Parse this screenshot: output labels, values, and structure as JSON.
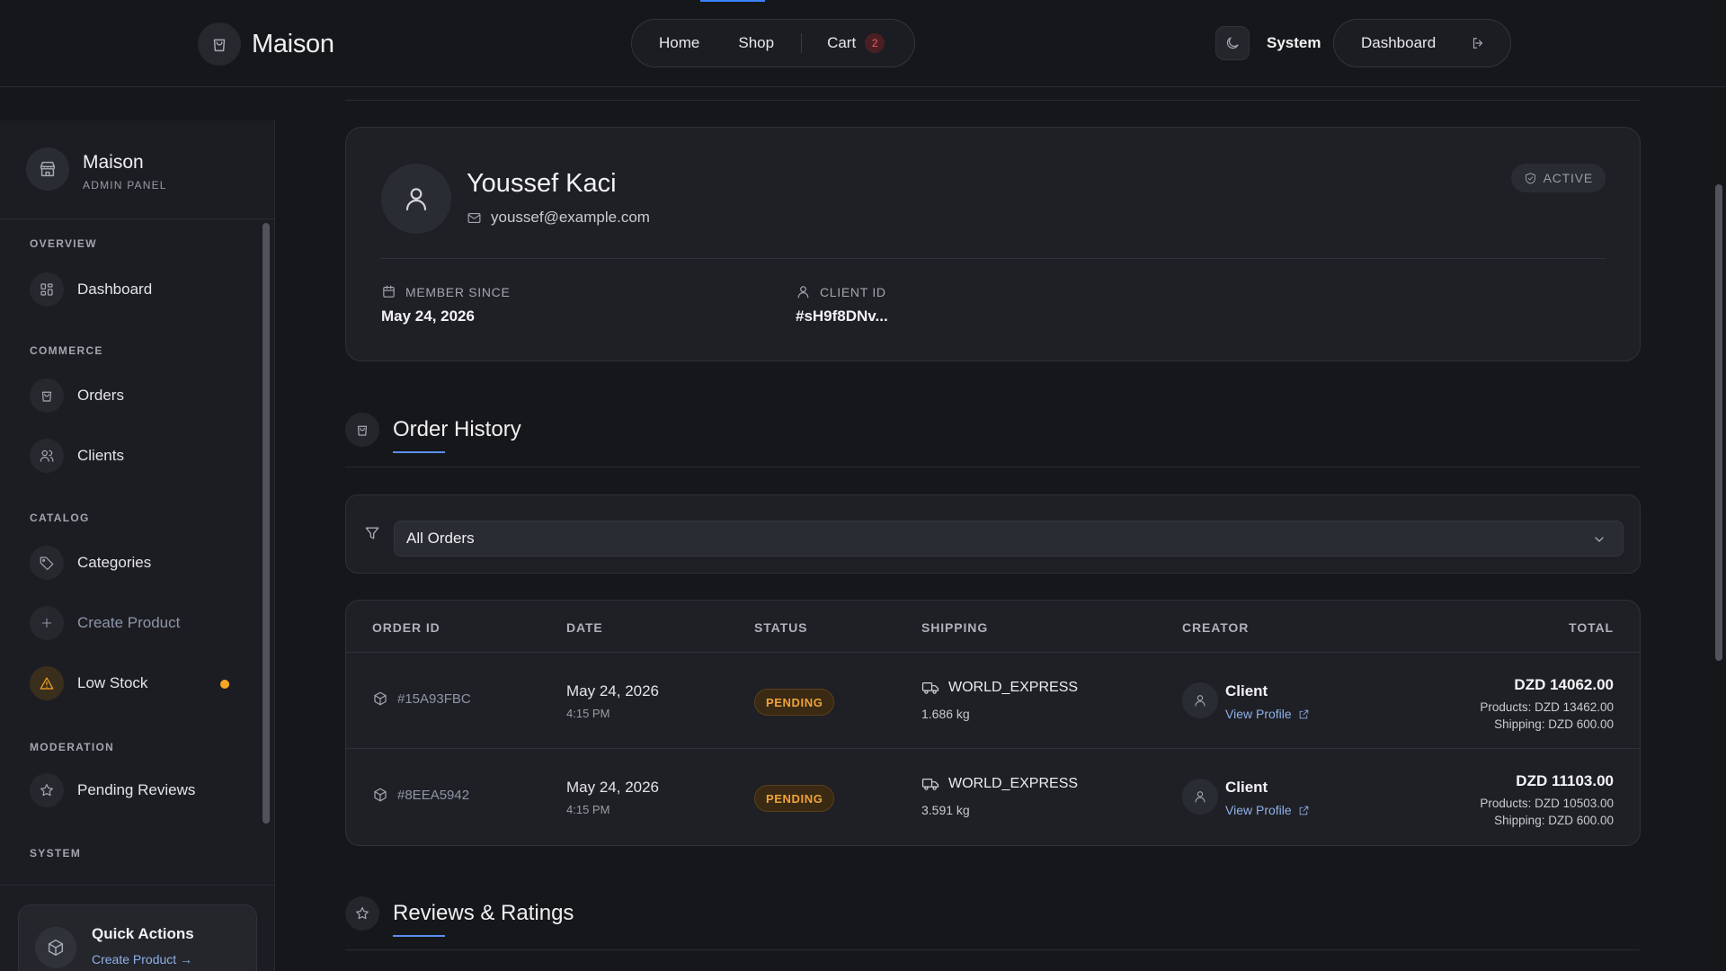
{
  "topbar": {
    "brand": "Maison",
    "nav": [
      {
        "label": "Home"
      },
      {
        "label": "Shop"
      },
      {
        "label": "Cart"
      }
    ],
    "cart_count": "2",
    "theme_label": "System",
    "dashboard_label": "Dashboard"
  },
  "sidebar": {
    "title": "Maison",
    "subtitle": "ADMIN PANEL",
    "sections": {
      "overview": "OVERVIEW",
      "commerce": "COMMERCE",
      "catalog": "CATALOG",
      "moderation": "MODERATION",
      "system": "SYSTEM"
    },
    "items": {
      "dashboard": "Dashboard",
      "orders": "Orders",
      "clients": "Clients",
      "categories": "Categories",
      "create_product": "Create Product",
      "low_stock": "Low Stock",
      "pending_reviews": "Pending Reviews"
    },
    "quick_actions": {
      "title": "Quick Actions",
      "link": "Create Product →"
    }
  },
  "profile": {
    "name": "Youssef Kaci",
    "email": "youssef@example.com",
    "status": "ACTIVE",
    "member_since_label": "MEMBER SINCE",
    "member_since": "May 24, 2026",
    "client_id_label": "CLIENT ID",
    "client_id": "#sH9f8DNv..."
  },
  "order_history": {
    "title": "Order History",
    "filter": {
      "selected": "All Orders"
    },
    "columns": [
      "ORDER ID",
      "DATE",
      "STATUS",
      "SHIPPING",
      "CREATOR",
      "TOTAL"
    ],
    "rows": [
      {
        "id": "#15A93FBC",
        "date": "May 24, 2026",
        "time": "4:15 PM",
        "status": "PENDING",
        "shipping": "WORLD_EXPRESS",
        "weight": "1.686 kg",
        "creator": "Client",
        "creator_link": "View Profile",
        "total": "DZD 14062.00",
        "products": "Products: DZD 13462.00",
        "shipping_cost": "Shipping: DZD 600.00"
      },
      {
        "id": "#8EEA5942",
        "date": "May 24, 2026",
        "time": "4:15 PM",
        "status": "PENDING",
        "shipping": "WORLD_EXPRESS",
        "weight": "3.591 kg",
        "creator": "Client",
        "creator_link": "View Profile",
        "total": "DZD 11103.00",
        "products": "Products: DZD 10503.00",
        "shipping_cost": "Shipping: DZD 600.00"
      }
    ]
  },
  "reviews": {
    "title": "Reviews & Ratings"
  },
  "colors": {
    "background": "#16171b",
    "card": "#1f2025",
    "accent_blue": "#3b82f6",
    "pending": "#f0a23a",
    "warning": "#f5a623",
    "badge_red": "#ef5b62"
  }
}
